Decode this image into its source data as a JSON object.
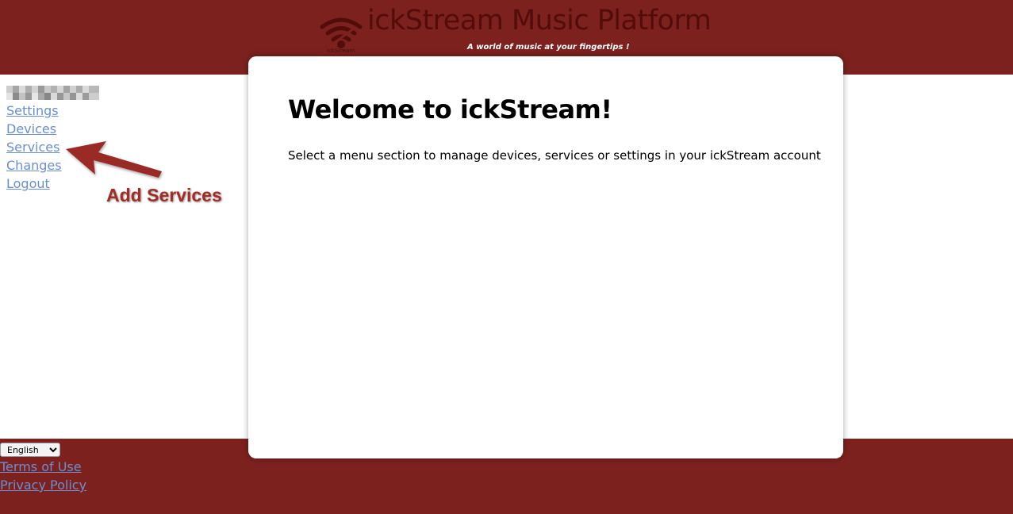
{
  "header": {
    "site_title": "ickStream Music Platform",
    "tagline": "A world of music at your fingertips !",
    "logo_caption": "ickStream",
    "logo_icon": "wifi-signal-icon",
    "background_color": "#7c211e"
  },
  "sidebar": {
    "user_name": "",
    "items": [
      {
        "label": "Settings"
      },
      {
        "label": "Devices"
      },
      {
        "label": "Services"
      },
      {
        "label": "Changes"
      },
      {
        "label": "Logout"
      }
    ],
    "link_color": "#6a8fd0"
  },
  "annotation": {
    "text": "Add Services",
    "icon": "arrow-icon",
    "color": "#a02d26"
  },
  "main": {
    "heading": "Welcome to ickStream!",
    "text": "Select a menu section to manage devices, services or settings in your ickStream account"
  },
  "footer": {
    "language_selected": "English",
    "links": [
      {
        "label": "Terms of Use"
      },
      {
        "label": "Privacy Policy"
      }
    ],
    "background_color": "#7c211e"
  }
}
